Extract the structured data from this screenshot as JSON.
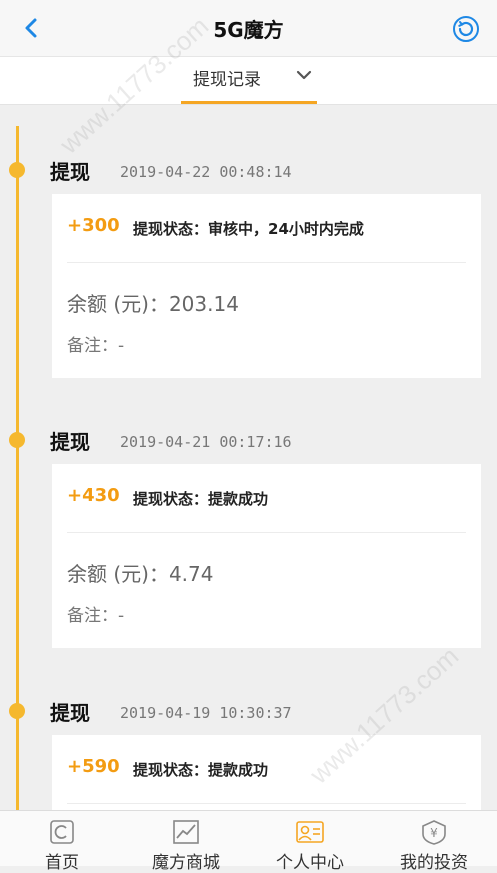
{
  "header": {
    "title": "5G魔方"
  },
  "tab": {
    "label": "提现记录"
  },
  "entries": [
    {
      "title": "提现",
      "time": "2019-04-22 00:48:14",
      "amount": "+300",
      "status": "提现状态：审核中，24小时内完成",
      "balance": "余额 (元)：203.14",
      "note": "备注：-"
    },
    {
      "title": "提现",
      "time": "2019-04-21 00:17:16",
      "amount": "+430",
      "status": "提现状态：提款成功",
      "balance": "余额 (元)：4.74",
      "note": "备注：-"
    },
    {
      "title": "提现",
      "time": "2019-04-19 10:30:37",
      "amount": "+590",
      "status": "提现状态：提款成功"
    }
  ],
  "nav": [
    {
      "label": "首页",
      "icon": "home-icon"
    },
    {
      "label": "魔方商城",
      "icon": "chart-icon"
    },
    {
      "label": "个人中心",
      "icon": "profile-icon"
    },
    {
      "label": "我的投资",
      "icon": "yen-icon"
    }
  ],
  "watermark": "www.11773.com",
  "colors": {
    "accent": "#f5b82e",
    "amount": "#f39c12",
    "link": "#1e88e5"
  }
}
